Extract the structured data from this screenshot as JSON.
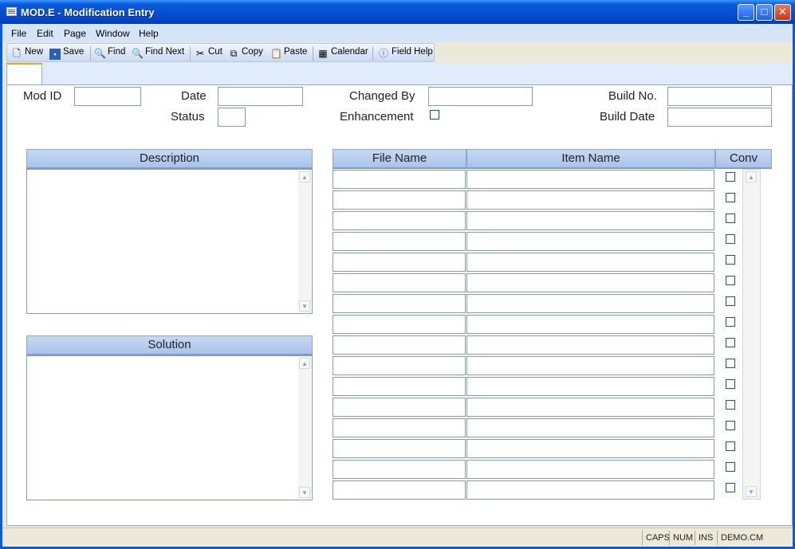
{
  "window": {
    "title": "MOD.E - Modification Entry",
    "app_icon": "table-icon"
  },
  "controls": {
    "minimize": "_",
    "maximize": "□",
    "close": "✕"
  },
  "menu": [
    "File",
    "Edit",
    "Page",
    "Window",
    "Help"
  ],
  "toolbar": {
    "new": "New",
    "save": "Save",
    "find": "Find",
    "find_next": "Find Next",
    "cut": "Cut",
    "copy": "Copy",
    "paste": "Paste",
    "calendar": "Calendar",
    "field_help": "Field Help"
  },
  "form": {
    "mod_id_label": "Mod ID",
    "date_label": "Date",
    "status_label": "Status",
    "changed_by_label": "Changed By",
    "enhancement_label": "Enhancement",
    "build_no_label": "Build No.",
    "build_date_label": "Build Date",
    "mod_id": "",
    "date": "",
    "status": "",
    "changed_by": "",
    "build_no": "",
    "build_date": ""
  },
  "description": {
    "header": "Description",
    "value": ""
  },
  "solution": {
    "header": "Solution",
    "value": ""
  },
  "files_table": {
    "headers": {
      "file_name": "File Name",
      "item_name": "Item Name",
      "conv": "Conv"
    },
    "rows": 16
  },
  "status": {
    "caps": "CAPS",
    "num": "NUM",
    "ins": "INS",
    "account": "DEMO.CM"
  }
}
